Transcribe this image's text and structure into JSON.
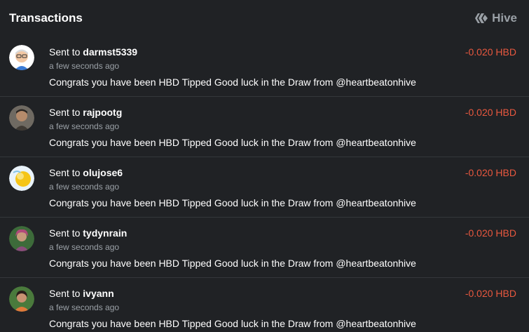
{
  "header": {
    "title": "Transactions",
    "brand_label": "Hive",
    "brand_icon": "hive-logo-icon"
  },
  "colors": {
    "background": "#202225",
    "text": "#ffffff",
    "muted": "#9aa0a6",
    "negative_amount": "#e8583f",
    "divider": "#34373b"
  },
  "transactions": [
    {
      "prefix": "Sent to",
      "user": "darmst5339",
      "time": "a few seconds ago",
      "memo": "Congrats you have been HBD Tipped Good luck in the Draw from @heartbeatonhive",
      "amount": "-0.020 HBD"
    },
    {
      "prefix": "Sent to",
      "user": "rajpootg",
      "time": "a few seconds ago",
      "memo": "Congrats you have been HBD Tipped Good luck in the Draw from @heartbeatonhive",
      "amount": "-0.020 HBD"
    },
    {
      "prefix": "Sent to",
      "user": "olujose6",
      "time": "a few seconds ago",
      "memo": "Congrats you have been HBD Tipped Good luck in the Draw from @heartbeatonhive",
      "amount": "-0.020 HBD"
    },
    {
      "prefix": "Sent to",
      "user": "tydynrain",
      "time": "a few seconds ago",
      "memo": "Congrats you have been HBD Tipped Good luck in the Draw from @heartbeatonhive",
      "amount": "-0.020 HBD"
    },
    {
      "prefix": "Sent to",
      "user": "ivyann",
      "time": "a few seconds ago",
      "memo": "Congrats you have been HBD Tipped Good luck in the Draw from @heartbeatonhive",
      "amount": "-0.020 HBD"
    }
  ]
}
